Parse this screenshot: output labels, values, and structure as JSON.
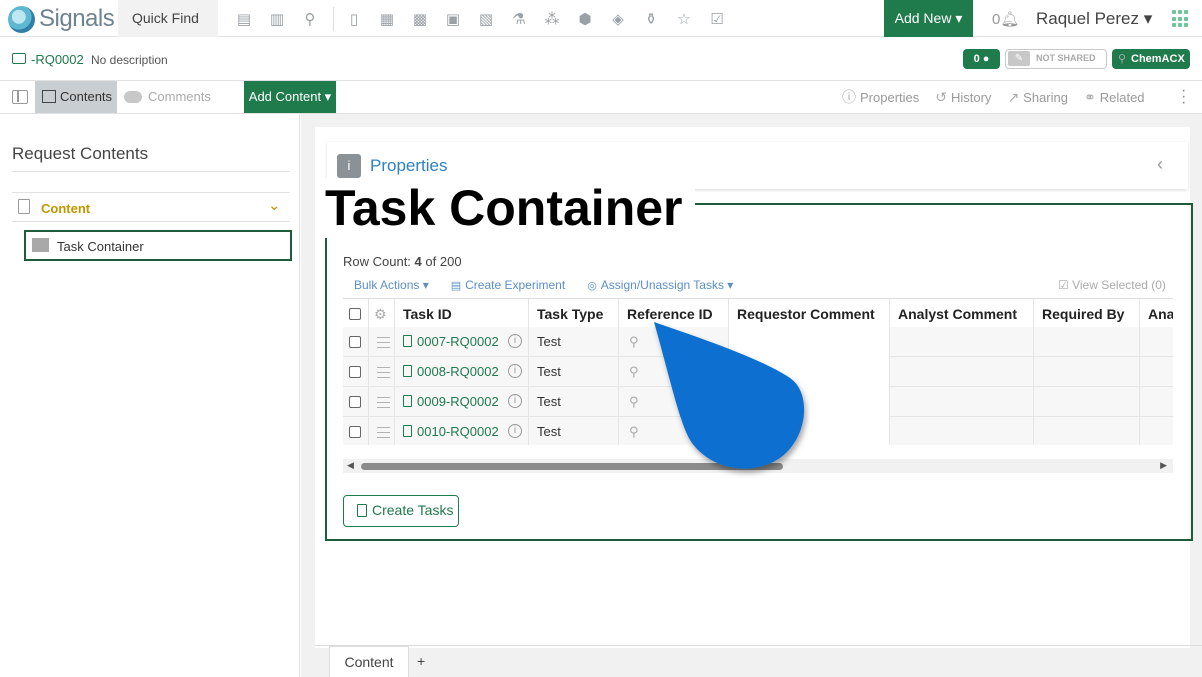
{
  "topbar": {
    "logo_text": "Signals",
    "quick_find": "Quick Find",
    "add_new": "Add New ▾",
    "notif_count": "0",
    "user_name": "Raquel Perez ▾"
  },
  "request": {
    "id": "-RQ0002",
    "description": "No description",
    "comment_count": "0",
    "sharing_badge": "NOT SHARED",
    "chem_badge": "ChemACX"
  },
  "toolbar": {
    "tab_contents": "Contents",
    "tab_comments": "Comments",
    "add_content": "Add Content ▾",
    "right_tabs": [
      {
        "icon": "ⓘ",
        "label": "Properties"
      },
      {
        "icon": "↺",
        "label": "History"
      },
      {
        "icon": "↗",
        "label": "Sharing"
      },
      {
        "icon": "⚭",
        "label": "Related"
      }
    ]
  },
  "left_panel": {
    "title": "Request Contents",
    "section_label": "Content",
    "item_label": "Task Container"
  },
  "main": {
    "properties_label": "Properties",
    "container_title": "Task Container",
    "row_count_prefix": "Row Count:",
    "row_count_value": "4",
    "row_count_suffix": "of 200",
    "actions": {
      "bulk": "Bulk Actions ▾",
      "create_experiment": "Create Experiment",
      "assign": "Assign/Unassign Tasks ▾",
      "view_selected": "View Selected (0)"
    },
    "columns": [
      "Task ID",
      "Task Type",
      "Reference ID",
      "Requestor Comment",
      "Analyst Comment",
      "Required By",
      "Analyst"
    ],
    "rows": [
      {
        "task_id": "0007-RQ0002",
        "task_type": "Test"
      },
      {
        "task_id": "0008-RQ0002",
        "task_type": "Test"
      },
      {
        "task_id": "0009-RQ0002",
        "task_type": "Test"
      },
      {
        "task_id": "0010-RQ0002",
        "task_type": "Test"
      }
    ],
    "create_tasks": "Create Tasks"
  },
  "bottom": {
    "tab_label": "Content",
    "add_tab": "+"
  },
  "colors": {
    "brand_green": "#1f7a4c",
    "link_blue": "#2f80c4",
    "accent_gold": "#c29600",
    "drop_blue": "#0b6fd0"
  }
}
